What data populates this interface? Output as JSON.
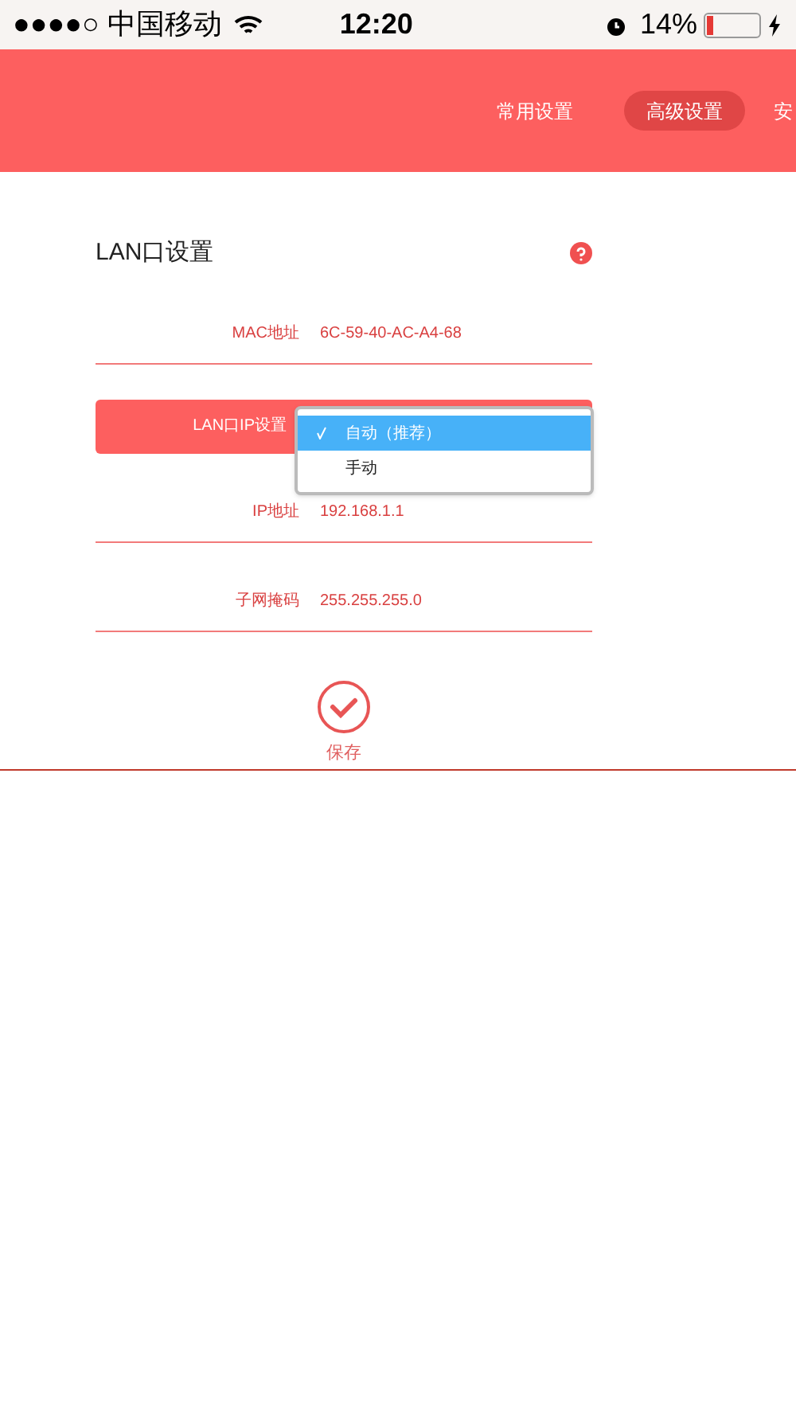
{
  "status_bar": {
    "carrier": "●●●●○ 中国移动",
    "time": "12:20",
    "battery": "14%"
  },
  "tabs": [
    {
      "label": "常用设置",
      "selected": false
    },
    {
      "label": "高级设置",
      "selected": true
    },
    {
      "label": "安",
      "selected": false
    }
  ],
  "section": {
    "title": "LAN口设置"
  },
  "rows": [
    {
      "label": "MAC地址",
      "value": "6C-59-40-AC-A4-68",
      "kind": "text"
    },
    {
      "label": "LAN口IP设置",
      "kind": "select"
    },
    {
      "label": "IP地址",
      "value": "192.168.1.1",
      "kind": "text"
    },
    {
      "label": "子网掩码",
      "value": "255.255.255.0",
      "kind": "text"
    }
  ],
  "dropdown": {
    "options": [
      {
        "label": "自动（推荐）",
        "selected": true
      },
      {
        "label": "手动",
        "selected": false
      }
    ]
  },
  "save_button": {
    "label": "保存"
  }
}
